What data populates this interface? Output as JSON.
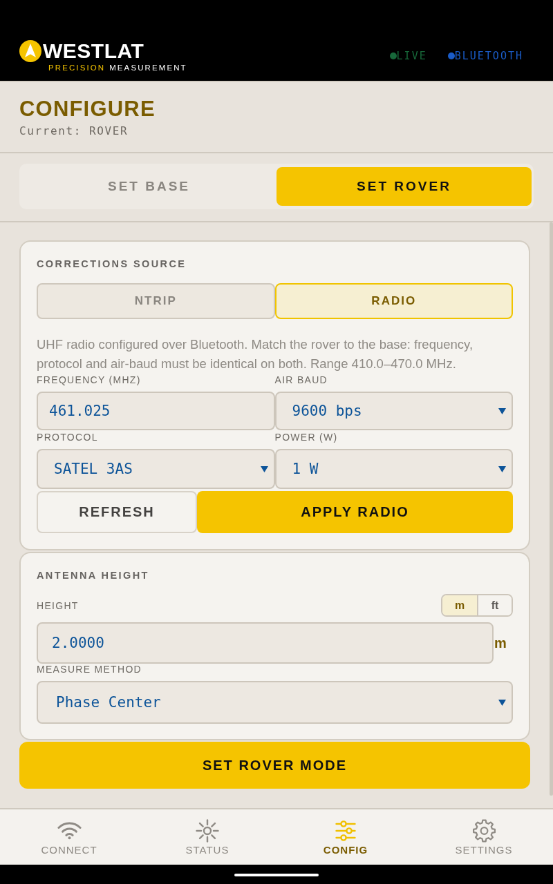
{
  "header": {
    "brand": "WESTLAT",
    "tagline_accent": "PRECISION",
    "tagline": "MEASUREMENT",
    "indicators": [
      {
        "label": "LIVE",
        "color": "#17683a"
      },
      {
        "label": "BLUETOOTH",
        "color": "#1a5cc8"
      }
    ]
  },
  "page": {
    "title": "CONFIGURE",
    "subtitle": "Current: ROVER"
  },
  "mode_tabs": [
    {
      "label": "SET BASE",
      "selected": false
    },
    {
      "label": "SET ROVER",
      "selected": true
    }
  ],
  "corrections": {
    "title": "CORRECTIONS SOURCE",
    "options": [
      {
        "label": "NTRIP",
        "selected": false
      },
      {
        "label": "RADIO",
        "selected": true
      }
    ],
    "description": "UHF radio configured over Bluetooth. Match the rover to the base: frequency, protocol and air-baud must be identical on both. Range 410.0–470.0 MHz.",
    "fields": [
      {
        "label": "FREQUENCY (MHZ)",
        "value": "461.025",
        "kind": "text"
      },
      {
        "label": "AIR BAUD",
        "value": "9600 bps",
        "kind": "select"
      },
      {
        "label": "PROTOCOL",
        "value": "SATEL 3AS",
        "kind": "select"
      },
      {
        "label": "POWER (W)",
        "value": "1 W",
        "kind": "select"
      }
    ],
    "buttons": [
      {
        "label": "REFRESH",
        "kind": "secondary"
      },
      {
        "label": "APPLY RADIO",
        "kind": "primary"
      }
    ]
  },
  "antenna": {
    "title": "ANTENNA HEIGHT",
    "height_label": "HEIGHT",
    "units": [
      {
        "label": "m",
        "selected": true
      },
      {
        "label": "ft",
        "selected": false
      }
    ],
    "height_value": "2.0000",
    "height_unit": "m",
    "method_label": "MEASURE METHOD",
    "method_value": "Phase Center"
  },
  "submit_button": "SET ROVER MODE",
  "bottom_nav": [
    {
      "label": "CONNECT",
      "selected": false
    },
    {
      "label": "STATUS",
      "selected": false
    },
    {
      "label": "CONFIG",
      "selected": true
    },
    {
      "label": "SETTINGS",
      "selected": false
    }
  ]
}
